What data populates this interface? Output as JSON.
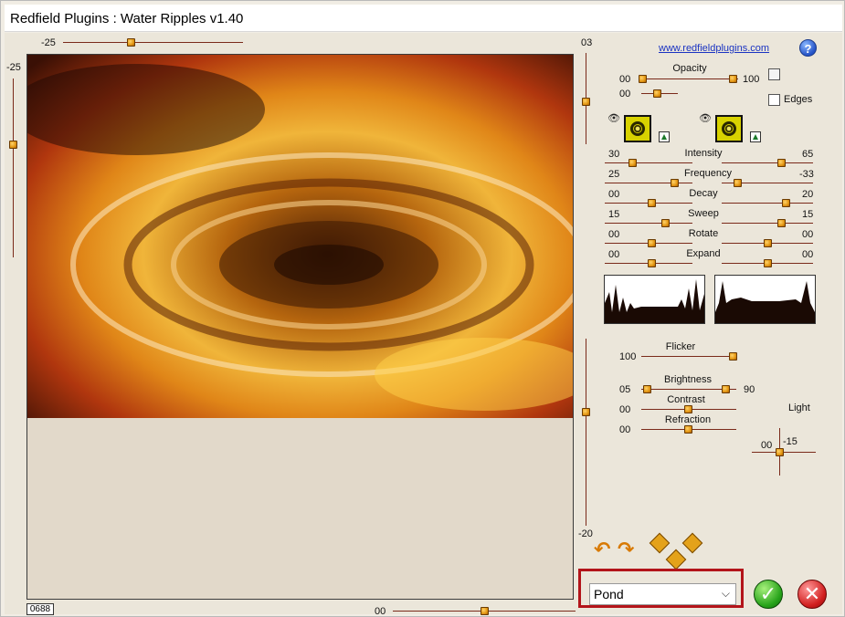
{
  "window": {
    "title": "Redfield Plugins : Water Ripples v1.40"
  },
  "link": "www.redfieldplugins.com",
  "help_label": "?",
  "top_slider": {
    "value": "-25"
  },
  "left_slider": {
    "value": "-25"
  },
  "right_vert_slider": {
    "top_value": "03",
    "bottom_value": "-20"
  },
  "bottom_slider": {
    "value": "00"
  },
  "zoom": "0688",
  "opacity": {
    "label": "Opacity",
    "left": "00",
    "right": "100",
    "second": "00"
  },
  "edges_label": "Edges",
  "params": [
    {
      "label": "Intensity",
      "left": "30",
      "right": "65"
    },
    {
      "label": "Frequency",
      "left": "25",
      "right": "-33"
    },
    {
      "label": "Decay",
      "left": "00",
      "right": "20"
    },
    {
      "label": "Sweep",
      "left": "15",
      "right": "15"
    },
    {
      "label": "Rotate",
      "left": "00",
      "right": "00"
    },
    {
      "label": "Expand",
      "left": "00",
      "right": "00"
    }
  ],
  "flicker": {
    "label": "Flicker",
    "value": "100"
  },
  "brightness": {
    "label": "Brightness",
    "left": "05",
    "right": "90"
  },
  "contrast": {
    "label": "Contrast",
    "value": "00"
  },
  "refraction": {
    "label": "Refraction",
    "value": "00"
  },
  "light": {
    "label": "Light",
    "x": "00",
    "y": "-15"
  },
  "preset": {
    "selected": "Pond"
  },
  "ok_label": "✓",
  "cancel_label": "✕"
}
